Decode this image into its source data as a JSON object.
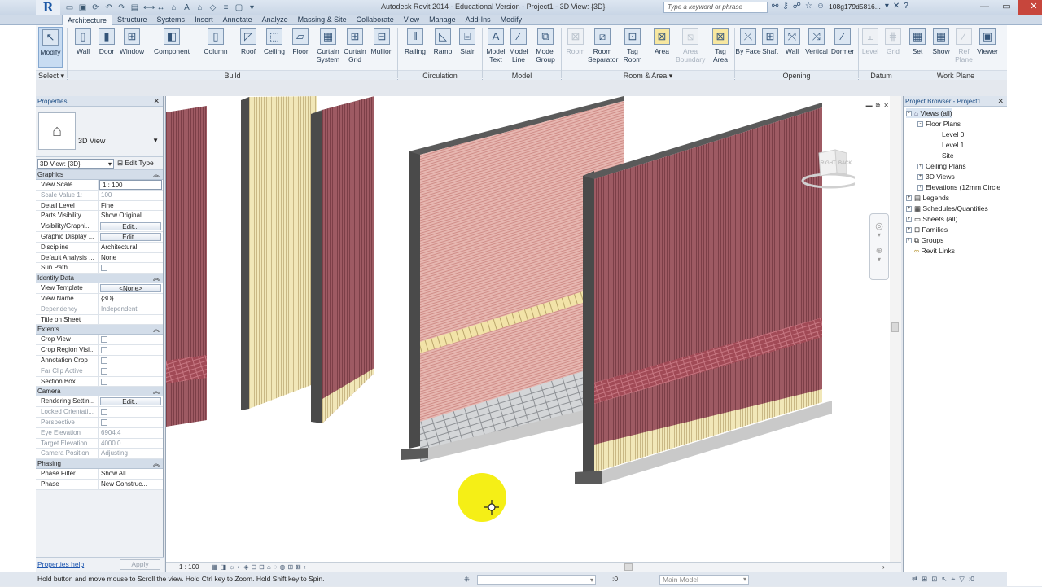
{
  "app": {
    "title": "Autodesk Revit 2014 - Educational Version -     Project1 - 3D View: {3D}",
    "logo_letter": "R",
    "search_placeholder": "Type a keyword or phrase",
    "user": "108g179d5816...",
    "qat_icons": [
      "open-icon",
      "save-icon",
      "sync-icon",
      "undo-icon",
      "redo-icon",
      "print-icon",
      "measure-icon",
      "dimension-icon",
      "tag-icon",
      "text-icon",
      "3d-view-icon",
      "section-icon",
      "thin-lines-icon",
      "close-hidden-icon",
      "switch-windows-icon"
    ]
  },
  "ribbon": {
    "tabs": [
      "Architecture",
      "Structure",
      "Systems",
      "Insert",
      "Annotate",
      "Analyze",
      "Massing & Site",
      "Collaborate",
      "View",
      "Manage",
      "Add-Ins",
      "Modify"
    ],
    "active_tab": "Architecture",
    "buttons": {
      "modify": "Modify",
      "wall": "Wall",
      "door": "Door",
      "window": "Window",
      "component": "Component",
      "column": "Column",
      "roof": "Roof",
      "ceiling": "Ceiling",
      "floor": "Floor",
      "curtain_system": "Curtain System",
      "curtain_grid": "Curtain Grid",
      "mullion": "Mullion",
      "railing": "Railing",
      "ramp": "Ramp",
      "stair": "Stair",
      "model_text": "Model Text",
      "model_line": "Model Line",
      "model_group": "Model Group",
      "room": "Room",
      "room_separator": "Room Separator",
      "tag_room": "Tag Room",
      "area": "Area",
      "area_boundary": "Area Boundary",
      "tag_area": "Tag Area",
      "by_face": "By Face",
      "shaft": "Shaft",
      "opening_wall": "Wall",
      "vertical": "Vertical",
      "dormer": "Dormer",
      "level": "Level",
      "grid": "Grid",
      "set": "Set",
      "show": "Show",
      "ref_plane": "Ref Plane",
      "viewer": "Viewer"
    },
    "groups": {
      "select": "Select",
      "build": "Build",
      "circulation": "Circulation",
      "model": "Model",
      "room_area": "Room & Area",
      "opening": "Opening",
      "datum": "Datum",
      "work_plane": "Work Plane"
    }
  },
  "properties": {
    "title": "Properties",
    "type_name": "3D View",
    "instance_selector": "3D View: {3D}",
    "edit_type": "Edit Type",
    "categories": {
      "graphics": "Graphics",
      "identity": "Identity Data",
      "extents": "Extents",
      "camera": "Camera",
      "phasing": "Phasing"
    },
    "graphics": [
      {
        "k": "View Scale",
        "v": "1 : 100"
      },
      {
        "k": "Scale Value    1:",
        "v": "100"
      },
      {
        "k": "Detail Level",
        "v": "Fine"
      },
      {
        "k": "Parts Visibility",
        "v": "Show Original"
      },
      {
        "k": "Visibility/Graphi...",
        "v": "Edit..."
      },
      {
        "k": "Graphic Display ...",
        "v": "Edit..."
      },
      {
        "k": "Discipline",
        "v": "Architectural"
      },
      {
        "k": "Default Analysis ...",
        "v": "None"
      },
      {
        "k": "Sun Path",
        "v": ""
      }
    ],
    "identity": [
      {
        "k": "View Template",
        "v": "<None>"
      },
      {
        "k": "View Name",
        "v": "{3D}"
      },
      {
        "k": "Dependency",
        "v": "Independent"
      },
      {
        "k": "Title on Sheet",
        "v": ""
      }
    ],
    "extents": [
      {
        "k": "Crop View",
        "v": ""
      },
      {
        "k": "Crop Region Visi...",
        "v": ""
      },
      {
        "k": "Annotation Crop",
        "v": ""
      },
      {
        "k": "Far Clip Active",
        "v": ""
      },
      {
        "k": "Section Box",
        "v": ""
      }
    ],
    "camera": [
      {
        "k": "Rendering Settin...",
        "v": "Edit..."
      },
      {
        "k": "Locked Orientati...",
        "v": ""
      },
      {
        "k": "Perspective",
        "v": ""
      },
      {
        "k": "Eye Elevation",
        "v": "6904.4"
      },
      {
        "k": "Target Elevation",
        "v": "4000.0"
      },
      {
        "k": "Camera Position",
        "v": "Adjusting"
      }
    ],
    "phasing": [
      {
        "k": "Phase Filter",
        "v": "Show All"
      },
      {
        "k": "Phase",
        "v": "New Construc..."
      }
    ],
    "help_link": "Properties help",
    "apply": "Apply"
  },
  "viewport": {
    "viewcube_right": "RIGHT",
    "viewcube_back": "BACK",
    "scale": "1 : 100",
    "colors": {
      "brick": "#9e5a63",
      "stucco": "#e3b4ae",
      "timber": "#f1e7b8",
      "stone": "#c9cbcd",
      "concrete": "#5a5a5a",
      "cursor": "#f5ef16"
    }
  },
  "browser": {
    "title": "Project Browser - Project1",
    "nodes": [
      {
        "label": "Views (all)",
        "level": 0,
        "exp": "-",
        "icon": "views"
      },
      {
        "label": "Floor Plans",
        "level": 1,
        "exp": "-"
      },
      {
        "label": "Level 0",
        "level": 2,
        "exp": ""
      },
      {
        "label": "Level 1",
        "level": 2,
        "exp": ""
      },
      {
        "label": "Site",
        "level": 2,
        "exp": ""
      },
      {
        "label": "Ceiling Plans",
        "level": 1,
        "exp": "+"
      },
      {
        "label": "3D Views",
        "level": 1,
        "exp": "+"
      },
      {
        "label": "Elevations (12mm Circle",
        "level": 1,
        "exp": "+"
      },
      {
        "label": "Legends",
        "level": 0,
        "exp": "+",
        "icon": "legend"
      },
      {
        "label": "Schedules/Quantities",
        "level": 0,
        "exp": "+",
        "icon": "sched"
      },
      {
        "label": "Sheets (all)",
        "level": 0,
        "exp": "+",
        "icon": "sheet"
      },
      {
        "label": "Families",
        "level": 0,
        "exp": "+",
        "icon": "fam"
      },
      {
        "label": "Groups",
        "level": 0,
        "exp": "+",
        "icon": "grp"
      },
      {
        "label": "Revit Links",
        "level": 0,
        "exp": "",
        "icon": "link"
      }
    ]
  },
  "status": {
    "text": "Hold button and move mouse to Scroll the view. Hold Ctrl key to Zoom. Hold Shift key to Spin.",
    "zero": ":0",
    "model": "Main Model",
    "filter": ":0"
  }
}
